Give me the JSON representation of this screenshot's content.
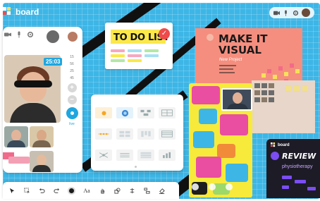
{
  "app": {
    "brand": "board"
  },
  "video_call": {
    "timer": "25:03",
    "side_numbers": [
      "15",
      "56",
      "25",
      "45"
    ],
    "live_label": "live"
  },
  "todo_card": {
    "title": "TO DO LIST"
  },
  "poster": {
    "title_line1": "MAKE IT",
    "title_line2": "VISUAL",
    "subtitle": "New Project"
  },
  "review_window": {
    "brand": "board",
    "title": "REVIEW",
    "subtitle": "physiotherapy"
  },
  "toolbar": {
    "text_tool_label": "Aa"
  },
  "colors": {
    "canvas": "#3db6e6",
    "accent_blue": "#1fa6df",
    "poster": "#f58e7e",
    "map_yellow": "#f7ea3b",
    "review_dark": "#1c1b26",
    "review_purple": "#7b4df2"
  },
  "icons": {
    "toolbar": [
      "cursor-icon",
      "select-icon",
      "undo-icon",
      "redo-icon",
      "color-icon",
      "text-icon",
      "hand-icon",
      "shape-icon",
      "connector-icon",
      "align-icon",
      "eraser-icon"
    ]
  }
}
